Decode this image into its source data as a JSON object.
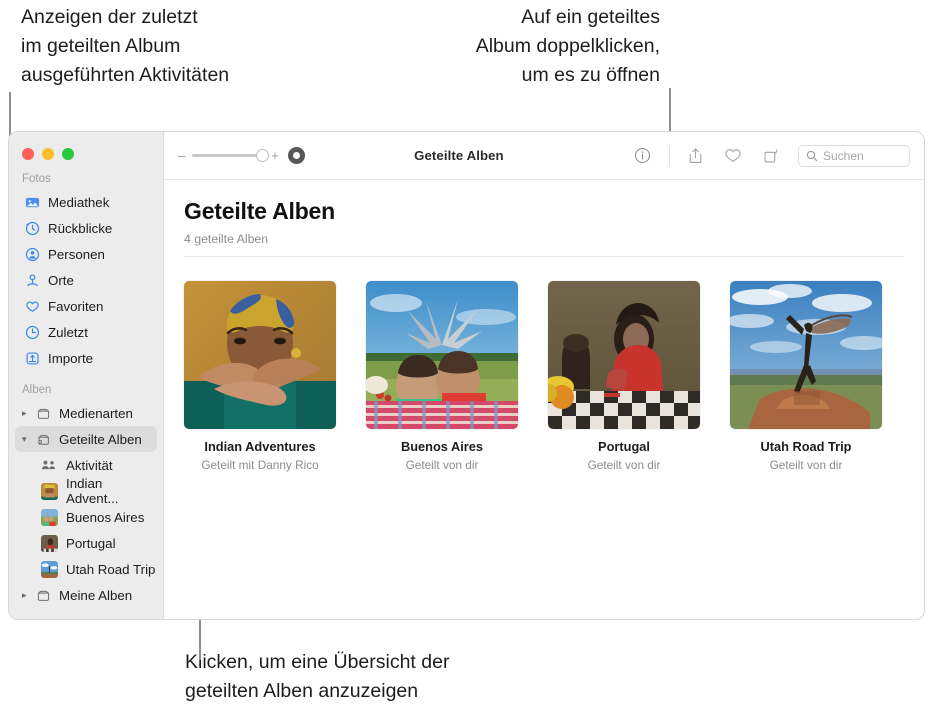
{
  "callouts": {
    "activity": "Anzeigen der zuletzt\nim geteilten Album\nausgeführten Aktivitäten",
    "doubleclick": "Auf ein geteiltes\nAlbum doppelklicken,\num es zu öffnen",
    "overview": "Klicken, um eine Übersicht der\ngeteilten Alben anzuzeigen"
  },
  "window": {
    "traffic_lights": [
      "close",
      "minimize",
      "zoom"
    ]
  },
  "toolbar": {
    "zoom_minus": "–",
    "zoom_plus": "+",
    "aspect_label": "aspect-ratio-button",
    "title": "Geteilte Alben",
    "info_label": "Info",
    "share_label": "Teilen",
    "favorite_label": "Favorit",
    "rotate_label": "Drehen",
    "search": {
      "placeholder": "Suchen",
      "value": ""
    }
  },
  "sidebar": {
    "groups": [
      {
        "title": "Fotos",
        "items": [
          {
            "label": "Mediathek",
            "icon": "photos-library-icon"
          },
          {
            "label": "Rückblicke",
            "icon": "memories-icon"
          },
          {
            "label": "Personen",
            "icon": "people-icon"
          },
          {
            "label": "Orte",
            "icon": "places-icon"
          },
          {
            "label": "Favoriten",
            "icon": "heart-icon"
          },
          {
            "label": "Zuletzt",
            "icon": "recents-clock-icon"
          },
          {
            "label": "Importe",
            "icon": "imports-icon"
          }
        ]
      },
      {
        "title": "Alben",
        "items": [
          {
            "label": "Medienarten",
            "icon": "folder-icon",
            "disclosure": "collapsed"
          },
          {
            "label": "Geteilte Alben",
            "icon": "shared-folder-icon",
            "disclosure": "expanded",
            "selected": true
          },
          {
            "label": "Aktivität",
            "icon": "activity-people-icon",
            "sub": true
          },
          {
            "label": "Indian Advent...",
            "icon": "album-thumb-indian",
            "sub": true
          },
          {
            "label": "Buenos Aires",
            "icon": "album-thumb-buenos",
            "sub": true
          },
          {
            "label": "Portugal",
            "icon": "album-thumb-portugal",
            "sub": true
          },
          {
            "label": "Utah Road Trip",
            "icon": "album-thumb-utah",
            "sub": true
          },
          {
            "label": "Meine Alben",
            "icon": "folder-icon",
            "disclosure": "collapsed"
          }
        ]
      }
    ]
  },
  "main": {
    "title": "Geteilte Alben",
    "subtitle": "4 geteilte Alben",
    "albums": [
      {
        "name": "Indian Adventures",
        "meta": "Geteilt mit Danny Rico"
      },
      {
        "name": "Buenos Aires",
        "meta": "Geteilt von dir"
      },
      {
        "name": "Portugal",
        "meta": "Geteilt von dir"
      },
      {
        "name": "Utah Road Trip",
        "meta": "Geteilt von dir"
      }
    ]
  },
  "colors": {
    "sidebar_bg": "#ececec",
    "selection": "#dcdcdc",
    "accent_icon": "#3b87f0",
    "leader_line": "#8e8e8e"
  }
}
